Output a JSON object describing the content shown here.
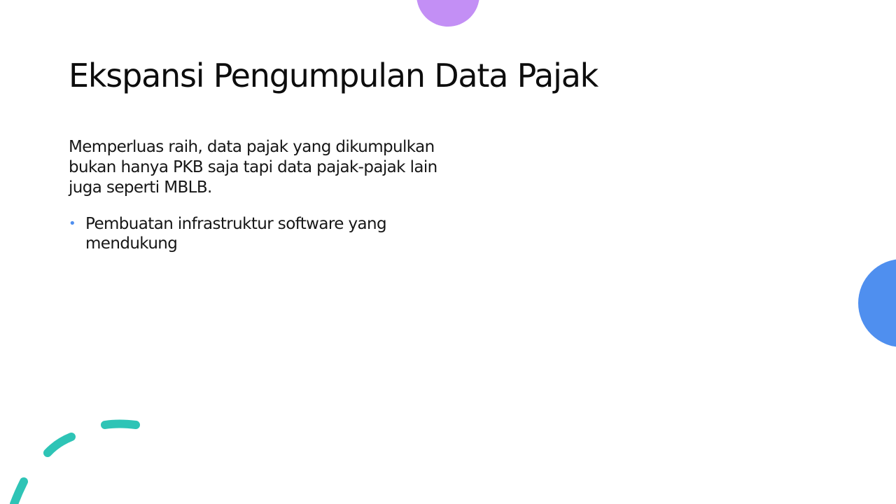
{
  "slide": {
    "title": "Ekspansi Pengumpulan Data Pajak",
    "paragraph": "Memperluas raih, data pajak yang dikumpulkan bukan hanya PKB saja tapi data pajak-pajak lain juga seperti MBLB.",
    "bullets": [
      {
        "marker": "•",
        "text": "Pembuatan infrastruktur software yang mendukung"
      }
    ]
  },
  "colors": {
    "purple_accent": "#c38ff5",
    "blue_accent": "#4f8fef",
    "teal_accent": "#2ec4b6",
    "bullet_marker": "#4f8fef"
  },
  "decorations": {
    "top_shape": "purple-circle",
    "right_shape": "blue-circle",
    "bottom_left_shape": "teal-dashed-arc"
  }
}
